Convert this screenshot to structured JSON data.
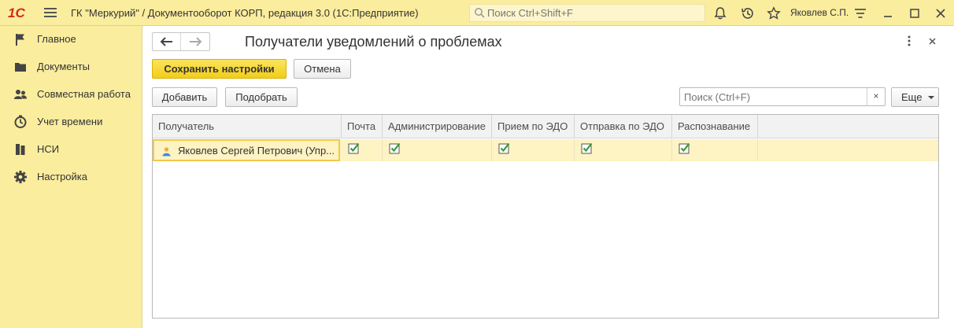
{
  "titlebar": {
    "logo": "1С",
    "title": "ГК \"Меркурий\" / Документооборот КОРП, редакция 3.0  (1С:Предприятие)",
    "search_placeholder": "Поиск Ctrl+Shift+F",
    "user": "Яковлев С.П.",
    "icons": [
      "menu-icon",
      "bell-icon",
      "history-icon",
      "star-icon",
      "settings-lines-icon",
      "minimize-icon",
      "maximize-icon",
      "close-icon"
    ]
  },
  "sidebar": {
    "items": [
      {
        "label": "Главное",
        "icon": "flag-icon"
      },
      {
        "label": "Документы",
        "icon": "folder-icon"
      },
      {
        "label": "Совместная работа",
        "icon": "people-icon"
      },
      {
        "label": "Учет времени",
        "icon": "clock-icon"
      },
      {
        "label": "НСИ",
        "icon": "books-icon"
      },
      {
        "label": "Настройка",
        "icon": "gear-icon"
      }
    ]
  },
  "main": {
    "title": "Получатели уведомлений о проблемах",
    "buttons": {
      "save": "Сохранить настройки",
      "cancel": "Отмена",
      "add": "Добавить",
      "pick": "Подобрать",
      "more": "Еще"
    },
    "search": {
      "placeholder": "Поиск (Ctrl+F)",
      "clear": "×"
    },
    "table": {
      "columns": [
        "Получатель",
        "Почта",
        "Администрирование",
        "Прием по ЭДО",
        "Отправка по ЭДО",
        "Распознавание"
      ],
      "rows": [
        {
          "recipient": "Яковлев Сергей Петрович (Упр...",
          "mail": true,
          "admin": true,
          "edo_in": true,
          "edo_out": true,
          "recognition": true
        }
      ]
    }
  },
  "colors": {
    "accent_yellow": "#fbed9e",
    "primary_button": "#f2cc1a",
    "selected_row": "#fdf3c3",
    "check_green": "#3a9a32"
  }
}
